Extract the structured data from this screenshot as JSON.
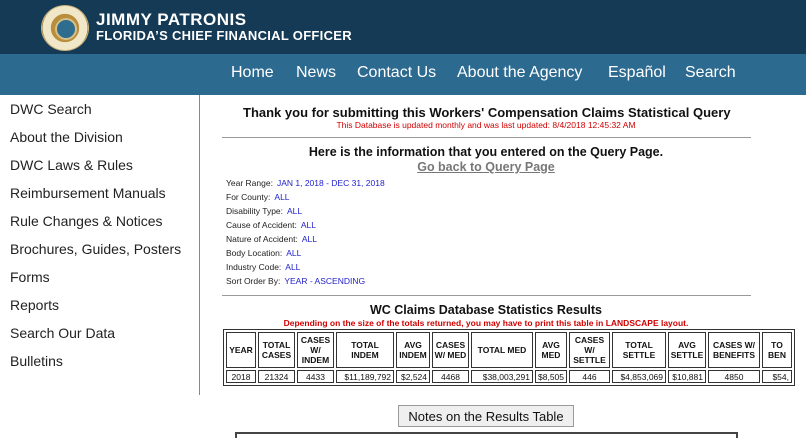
{
  "header": {
    "name": "JIMMY PATRONIS",
    "subtitle": "FLORIDA’S CHIEF FINANCIAL OFFICER",
    "seal_icon": "florida-cfo-seal-icon",
    "background": "#153a55"
  },
  "nav": {
    "background": "#2d6a90",
    "items": [
      "Home",
      "News",
      "Contact Us",
      "About the Agency",
      "Español",
      "Search"
    ]
  },
  "sidebar": {
    "items": [
      "DWC Search",
      "About the Division",
      "DWC Laws & Rules",
      "Reimbursement Manuals",
      "Rule Changes & Notices",
      "Brochures, Guides, Posters",
      "Forms",
      "Reports",
      "Search Our Data",
      "Bulletins"
    ]
  },
  "main": {
    "title": "Thank you for submitting this Workers' Compensation Claims Statistical Query",
    "updated_notice": "This Database is updated monthly and was last updated: 8/4/2018 12:45:32 AM",
    "info_title": "Here is the information that you entered on the Query Page.",
    "go_back": "Go back to Query Page",
    "query": [
      {
        "label": "Year Range:",
        "value": "JAN 1, 2018 - DEC 31, 2018"
      },
      {
        "label": "For County:",
        "value": "ALL"
      },
      {
        "label": "Disability Type:",
        "value": "ALL"
      },
      {
        "label": "Cause of Accident:",
        "value": "ALL"
      },
      {
        "label": "Nature of Accident:",
        "value": "ALL"
      },
      {
        "label": "Body Location:",
        "value": "ALL"
      },
      {
        "label": "Industry Code:",
        "value": "ALL"
      },
      {
        "label": "Sort Order By:",
        "value": "YEAR - ASCENDING"
      }
    ],
    "results_title": "WC Claims Database Statistics Results",
    "results_warning": "Depending on the size of the totals returned, you may have to print this table in LANDSCAPE layout.",
    "table": {
      "headers": [
        "YEAR",
        "TOTAL CASES",
        "CASES W/ INDEM",
        "TOTAL INDEM",
        "AVG INDEM",
        "CASES W/ MED",
        "TOTAL MED",
        "AVG MED",
        "CASES W/ SETTLE",
        "TOTAL SETTLE",
        "AVG SETTLE",
        "CASES W/ BENEFITS",
        "TO BEN"
      ],
      "row": [
        "2018",
        "21324",
        "4433",
        "$11,189,792",
        "$2,524",
        "4468",
        "$38,003,291",
        "$8,505",
        "446",
        "$4,853,069",
        "$10,881",
        "4850",
        "$54,"
      ]
    },
    "notes_button": "Notes on the Results Table"
  }
}
